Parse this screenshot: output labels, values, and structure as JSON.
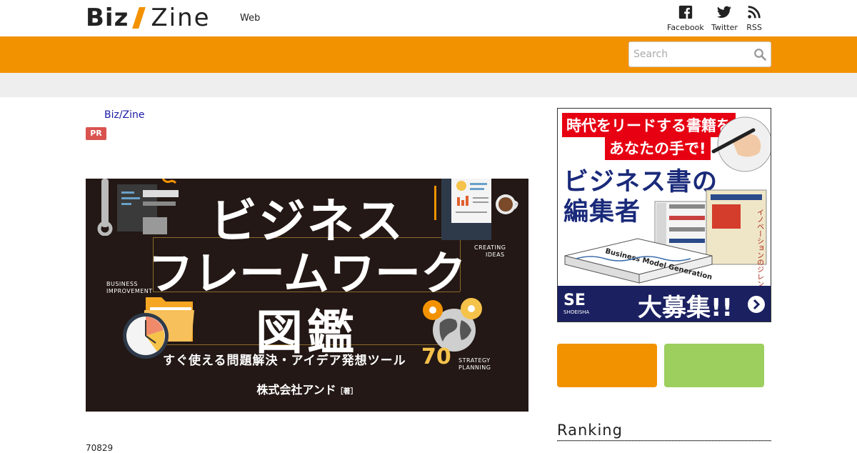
{
  "header": {
    "logo": {
      "part1": "Biz",
      "part2": "Zine"
    },
    "nav_web": "Web",
    "social": [
      {
        "label": "Facebook",
        "icon": "facebook-icon"
      },
      {
        "label": "Twitter",
        "icon": "twitter-icon"
      },
      {
        "label": "RSS",
        "icon": "rss-icon"
      }
    ],
    "search": {
      "placeholder": "Search",
      "icon": "search-icon"
    }
  },
  "colors": {
    "accent": "#f39200",
    "green": "#9ccf5e",
    "badge": "#d9534f",
    "hero_bg": "#231815"
  },
  "article": {
    "sponsor": "Biz/Zine",
    "badge": "PR",
    "hero": {
      "title_line1": "ビジネス",
      "title_line2": "フレームワーク",
      "title_line3": "図鑑",
      "subtitle": "すぐ使える問題解決・アイデア発想ツール",
      "count": "70",
      "publisher": "株式会社アンド",
      "publisher_suffix": "［著］",
      "label_creating": [
        "CREATING",
        "IDEAS"
      ],
      "label_business": [
        "BUSINESS",
        "IMPROVEMENT"
      ],
      "label_strategy": [
        "STRATEGY",
        "PLANNING"
      ]
    },
    "meta_number": "70829"
  },
  "sidebar": {
    "ad": {
      "headline1": "時代をリードする書籍を",
      "headline2": "あなたの手で!",
      "big1": "ビジネス書の",
      "big2": "編集者",
      "brand": "SE",
      "brand_sub": "SHOEISHA",
      "cta": "大募集!!",
      "book_spine": "イノベーションのジレンマ",
      "book_title": "Business Model Generation"
    },
    "ranking_title": "Ranking"
  }
}
